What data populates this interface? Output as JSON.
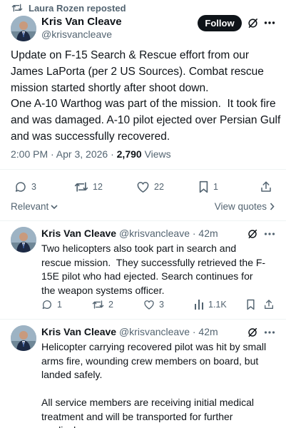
{
  "repost": {
    "label": "Laura Rozen reposted"
  },
  "main_post": {
    "name": "Kris Van Cleave",
    "handle": "@krisvancleave",
    "follow_label": "Follow",
    "text": "Update on F-15 Search & Rescue effort from our James LaPorta (per 2 US Sources). Combat rescue mission started shortly after shoot down.\nOne A-10 Warthog was part of the mission.  It took fire and was damaged. A-10 pilot ejected over Persian Gulf and was successfully recovered.",
    "timestamp": "2:00 PM · Apr 3, 2026 · ",
    "views_count": "2,790",
    "views_label": " Views",
    "replies": "3",
    "reposts": "12",
    "likes": "22",
    "bookmarks": "1"
  },
  "sort": {
    "relevant_label": "Relevant",
    "view_quotes_label": "View quotes"
  },
  "replies": [
    {
      "name": "Kris Van Cleave",
      "handle": "@krisvancleave",
      "time": " · 42m",
      "text": "Two helicopters also took part in search and rescue mission.  They successfully retrieved the F-15E pilot who had ejected. Search continues for the weapon systems officer.",
      "replies": "1",
      "reposts": "2",
      "likes": "3",
      "views": "1.1K"
    },
    {
      "name": "Kris Van Cleave",
      "handle": "@krisvancleave",
      "time": " · 42m",
      "text": "Helicopter carrying recovered pilot was hit by small arms fire, wounding crew members on board, but landed safely.\n\nAll service members are receiving initial medical treatment and will be transported for further medical care."
    }
  ],
  "icons": {
    "repost": "repost-icon",
    "grok": "grok-icon",
    "more": "more-icon",
    "reply": "reply-icon",
    "like": "heart-icon",
    "bookmark": "bookmark-icon",
    "share": "share-icon",
    "views": "views-icon"
  }
}
